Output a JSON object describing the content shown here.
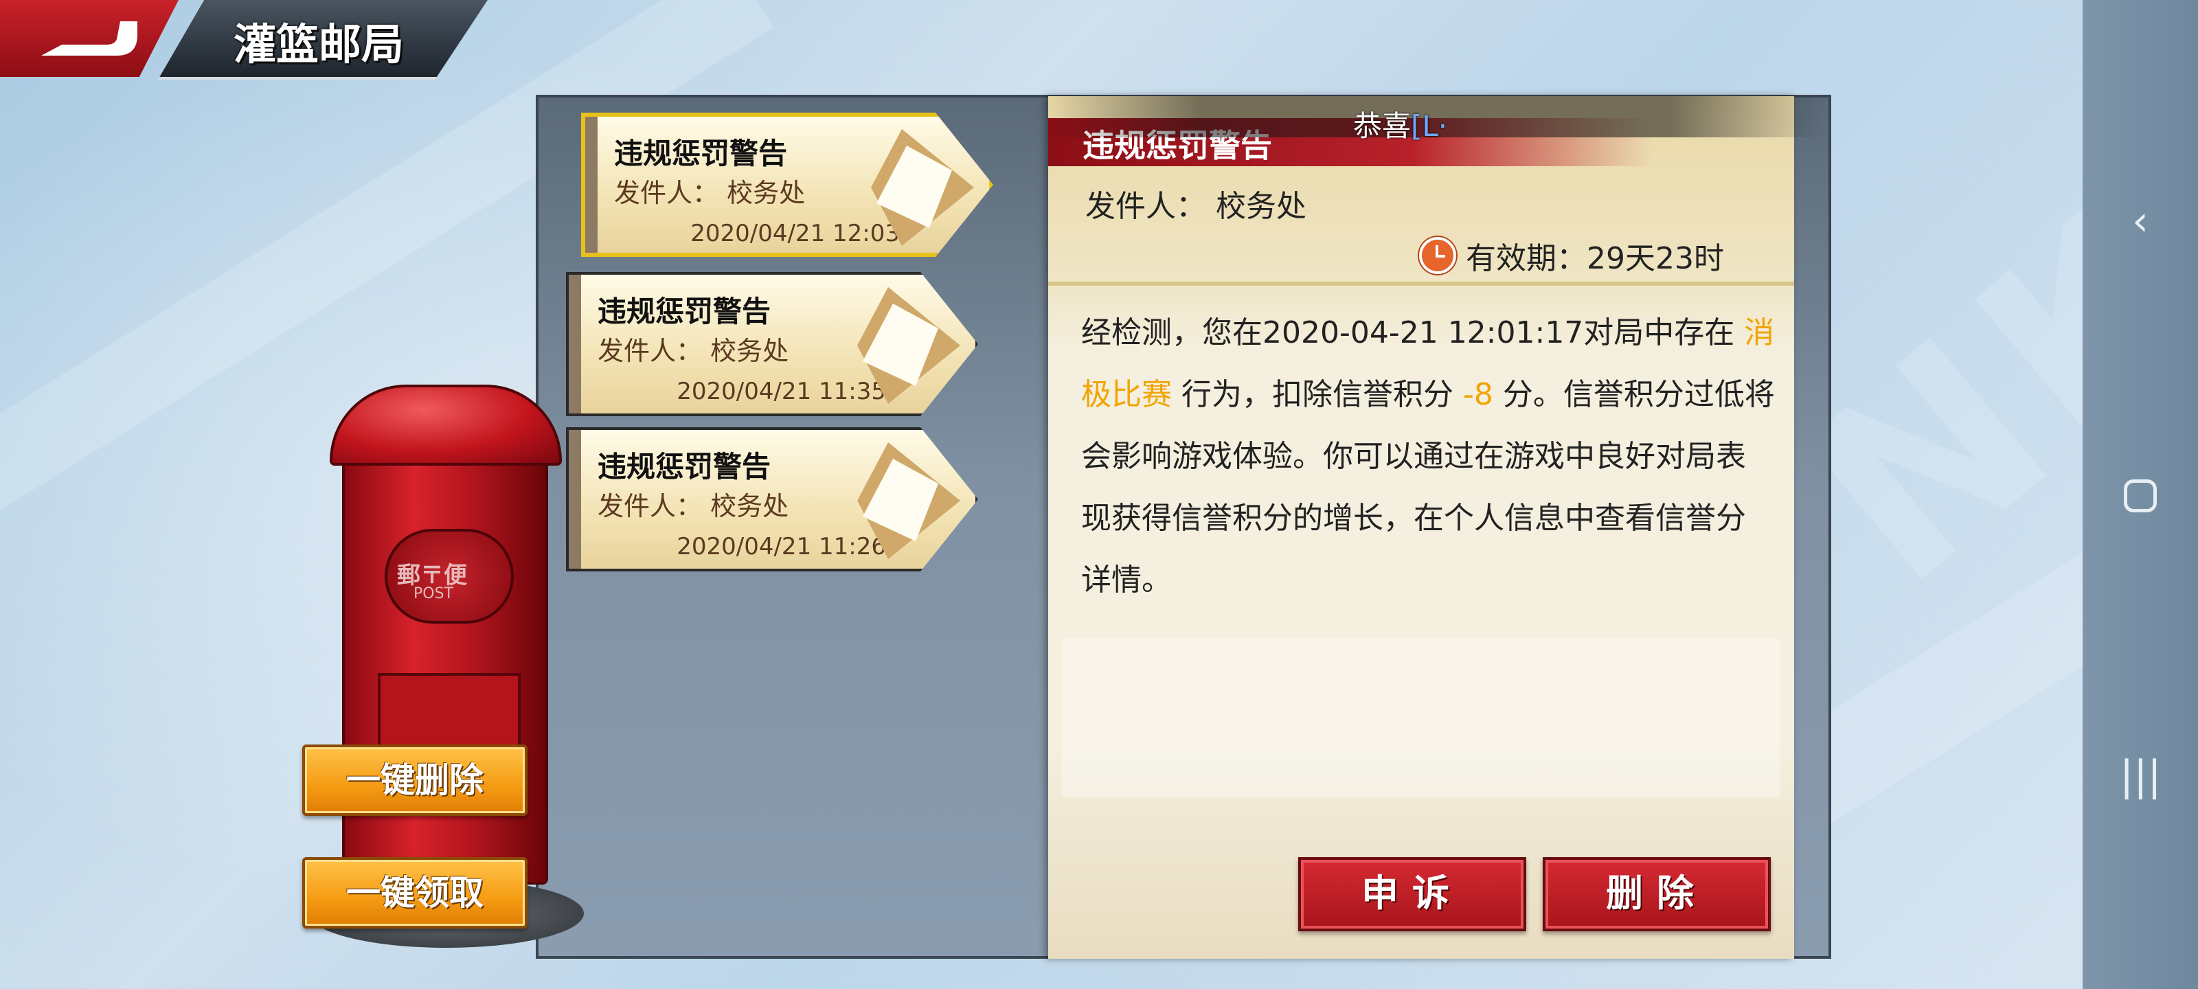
{
  "header": {
    "title": "灌篮邮局"
  },
  "top_bar": {
    "text": "恭喜",
    "extra": "[L·"
  },
  "mails": [
    {
      "title": "违规惩罚警告",
      "sender": "发件人： 校务处",
      "date": "2020/04/21 12:03",
      "selected": true
    },
    {
      "title": "违规惩罚警告",
      "sender": "发件人： 校务处",
      "date": "2020/04/21 11:35",
      "selected": false
    },
    {
      "title": "违规惩罚警告",
      "sender": "发件人： 校务处",
      "date": "2020/04/21 11:26",
      "selected": false
    }
  ],
  "detail": {
    "title": "违规惩罚警告",
    "sender": "发件人： 校务处",
    "validity": "有效期：29天23时",
    "body_part1": "经检测，您在2020-04-21 12:01:17对局中存在 ",
    "body_highlight1": "消极比赛",
    "body_part2": " 行为，扣除信誉积分 ",
    "body_highlight2": "-8",
    "body_part3": " 分。信誉积分过低将会影响游戏体验。你可以通过在游戏中良好对局表现获得信誉积分的增长，在个人信息中查看信誉分详情。",
    "appeal_button": "申诉",
    "delete_button": "删除"
  },
  "mailbox": {
    "label": "郵〒便",
    "label_small": "POST"
  },
  "buttons": {
    "delete_all": "一键删除",
    "claim_all": "一键领取"
  },
  "colors": {
    "accent_red": "#b8212a",
    "highlight": "#f2a400",
    "button_yellow": "#f59b12"
  }
}
